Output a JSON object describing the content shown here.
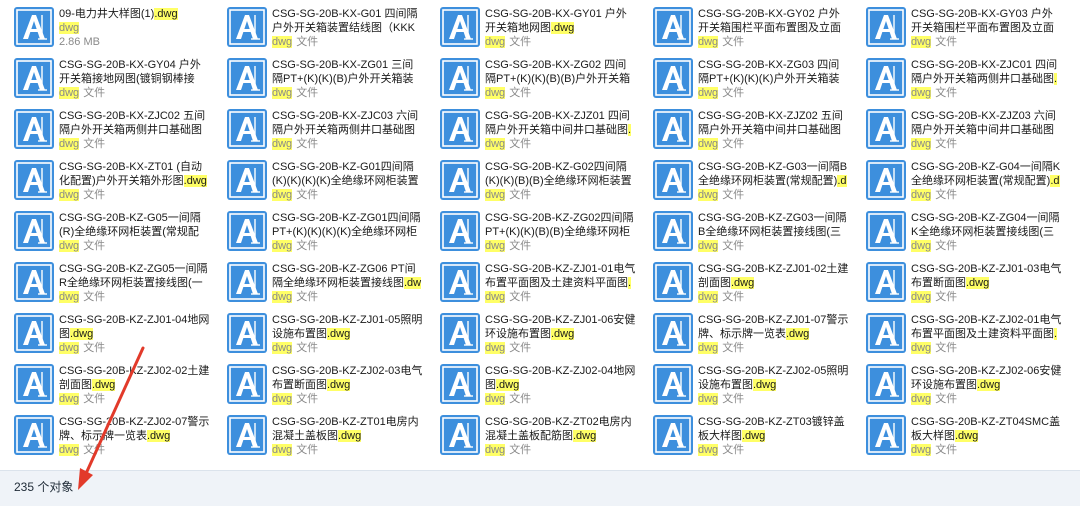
{
  "colors": {
    "icon_bg": "#3d8fdd",
    "icon_frame": "#ffffff",
    "highlight": "#ffff66",
    "arrow": "#e23a2a",
    "statusbar": "#eff3f8"
  },
  "file_icon": "autocad-dwg-icon",
  "items": [
    {
      "name_prefix": "09-电力井大样图(1)",
      "ext": ".dwg",
      "type_ext": "dwg",
      "type_suffix": "",
      "size": "2.86 MB"
    },
    {
      "name_prefix": "CSG-SG-20B-KX-G01 四间隔户外开关箱装置结线图（KKKK)(常规配置)",
      "ext": "",
      "type_ext": "dwg",
      "type_suffix": "文件",
      "size": ""
    },
    {
      "name_prefix": "CSG-SG-20B-KX-GY01 户外开关箱地网图",
      "ext": ".dwg",
      "type_ext": "dwg",
      "type_suffix": "文件",
      "size": ""
    },
    {
      "name_prefix": "CSG-SG-20B-KX-GY02 户外开关箱围栏平面布置图及立面图（两间隔）",
      "ext": "",
      "type_ext": "dwg",
      "type_suffix": "文件",
      "size": ""
    },
    {
      "name_prefix": "CSG-SG-20B-KX-GY03 户外开关箱围栏平面布置图及立面图（中间隔）",
      "ext": "",
      "type_ext": "dwg",
      "type_suffix": "文件",
      "size": ""
    },
    {
      "name_prefix": "CSG-SG-20B-KX-GY04 户外开关箱接地网图(镀铜钢棒接地)",
      "ext": ".dwg",
      "type_ext": "dwg",
      "type_suffix": "文件",
      "size": ""
    },
    {
      "name_prefix": "CSG-SG-20B-KX-ZG01 三间隔PT+(K)(K)(B)户外开关箱装置结线图",
      "ext": "",
      "type_ext": "dwg",
      "type_suffix": "文件",
      "size": ""
    },
    {
      "name_prefix": "CSG-SG-20B-KX-ZG02 四间隔PT+(K)(K)(B)(B)户外开关箱装置结线图",
      "ext": "",
      "type_ext": "dwg",
      "type_suffix": "文件",
      "size": ""
    },
    {
      "name_prefix": "CSG-SG-20B-KX-ZG03 四间隔PT+(K)(K)(K)户外开关箱装置结线图",
      "ext": "",
      "type_ext": "dwg",
      "type_suffix": "文件",
      "size": ""
    },
    {
      "name_prefix": "CSG-SG-20B-KX-ZJC01 四间隔户外开关箱两侧井口基础图",
      "ext": ".dwg",
      "type_ext": "dwg",
      "type_suffix": "文件",
      "size": ""
    },
    {
      "name_prefix": "CSG-SG-20B-KX-ZJC02 五间隔户外开关箱两侧井口基础图(自动化配置)",
      "ext": "",
      "type_ext": "dwg",
      "type_suffix": "文件",
      "size": ""
    },
    {
      "name_prefix": "CSG-SG-20B-KX-ZJC03 六间隔户外开关箱两侧井口基础图(自动化配置)",
      "ext": "",
      "type_ext": "dwg",
      "type_suffix": "文件",
      "size": ""
    },
    {
      "name_prefix": "CSG-SG-20B-KX-ZJZ01 四间隔户外开关箱中间井口基础图",
      "ext": ".dwg",
      "type_ext": "dwg",
      "type_suffix": "文件",
      "size": ""
    },
    {
      "name_prefix": "CSG-SG-20B-KX-ZJZ02 五间隔户外开关箱中间井口基础图(自动化配置)",
      "ext": "",
      "type_ext": "dwg",
      "type_suffix": "文件",
      "size": ""
    },
    {
      "name_prefix": "CSG-SG-20B-KX-ZJZ03 六间隔户外开关箱中间井口基础图(自动化配置)",
      "ext": "",
      "type_ext": "dwg",
      "type_suffix": "文件",
      "size": ""
    },
    {
      "name_prefix": "CSG-SG-20B-KX-ZT01 (自动化配置)户外开关箱外形图",
      "ext": ".dwg",
      "type_ext": "dwg",
      "type_suffix": "文件",
      "size": ""
    },
    {
      "name_prefix": "CSG-SG-20B-KZ-G01四间隔(K)(K)(K)(K)全绝缘环网柜装置(常规配置)",
      "ext": "",
      "type_ext": "dwg",
      "type_suffix": "文件",
      "size": ""
    },
    {
      "name_prefix": "CSG-SG-20B-KZ-G02四间隔(K)(K)(B)(B)全绝缘环网柜装置(常规配置)",
      "ext": "",
      "type_ext": "dwg",
      "type_suffix": "文件",
      "size": ""
    },
    {
      "name_prefix": "CSG-SG-20B-KZ-G03一间隔B全绝缘环网柜装置(常规配置)",
      "ext": ".dwg",
      "type_ext": "dwg",
      "type_suffix": "文件",
      "size": ""
    },
    {
      "name_prefix": "CSG-SG-20B-KZ-G04一间隔K全绝缘环网柜装置(常规配置)",
      "ext": ".dwg",
      "type_ext": "dwg",
      "type_suffix": "文件",
      "size": ""
    },
    {
      "name_prefix": "CSG-SG-20B-KZ-G05一间隔(R)全绝缘环网柜装置(常规配置)",
      "ext": ".dwg",
      "type_ext": "dwg",
      "type_suffix": "文件",
      "size": ""
    },
    {
      "name_prefix": "CSG-SG-20B-KZ-ZG01四间隔PT+(K)(K)(K)(K)全绝缘环网柜装置接线图",
      "ext": "",
      "type_ext": "dwg",
      "type_suffix": "文件",
      "size": ""
    },
    {
      "name_prefix": "CSG-SG-20B-KZ-ZG02四间隔PT+(K)(K)(B)(B)全绝缘环网柜装置接线图",
      "ext": "",
      "type_ext": "dwg",
      "type_suffix": "文件",
      "size": ""
    },
    {
      "name_prefix": "CSG-SG-20B-KZ-ZG03一间隔B全绝缘环网柜装置接线图(三遥配置)",
      "ext": ".dwg",
      "type_ext": "dwg",
      "type_suffix": "文件",
      "size": ""
    },
    {
      "name_prefix": "CSG-SG-20B-KZ-ZG04一间隔K全绝缘环网柜装置接线图(三遥配置)",
      "ext": ".dwg",
      "type_ext": "dwg",
      "type_suffix": "文件",
      "size": ""
    },
    {
      "name_prefix": "CSG-SG-20B-KZ-ZG05一间隔R全绝缘环网柜装置接线图(一遥配置)",
      "ext": ".dwg",
      "type_ext": "dwg",
      "type_suffix": "文件",
      "size": ""
    },
    {
      "name_prefix": "CSG-SG-20B-KZ-ZG06 PT间隔全绝缘环网柜装置接线图",
      "ext": ".dwg",
      "type_ext": "dwg",
      "type_suffix": "文件",
      "size": ""
    },
    {
      "name_prefix": "CSG-SG-20B-KZ-ZJ01-01电气布置平面图及土建资料平面图",
      "ext": ".dwg",
      "type_ext": "dwg",
      "type_suffix": "文件",
      "size": ""
    },
    {
      "name_prefix": "CSG-SG-20B-KZ-ZJ01-02土建剖面图",
      "ext": ".dwg",
      "type_ext": "dwg",
      "type_suffix": "文件",
      "size": ""
    },
    {
      "name_prefix": "CSG-SG-20B-KZ-ZJ01-03电气布置断面图",
      "ext": ".dwg",
      "type_ext": "dwg",
      "type_suffix": "文件",
      "size": ""
    },
    {
      "name_prefix": "CSG-SG-20B-KZ-ZJ01-04地网图",
      "ext": ".dwg",
      "type_ext": "dwg",
      "type_suffix": "文件",
      "size": ""
    },
    {
      "name_prefix": "CSG-SG-20B-KZ-ZJ01-05照明设施布置图",
      "ext": ".dwg",
      "type_ext": "dwg",
      "type_suffix": "文件",
      "size": ""
    },
    {
      "name_prefix": "CSG-SG-20B-KZ-ZJ01-06安健环设施布置图",
      "ext": ".dwg",
      "type_ext": "dwg",
      "type_suffix": "文件",
      "size": ""
    },
    {
      "name_prefix": "CSG-SG-20B-KZ-ZJ01-07警示牌、标示牌一览表",
      "ext": ".dwg",
      "type_ext": "dwg",
      "type_suffix": "文件",
      "size": ""
    },
    {
      "name_prefix": "CSG-SG-20B-KZ-ZJ02-01电气布置平面图及土建资料平面图",
      "ext": ".dwg",
      "type_ext": "dwg",
      "type_suffix": "文件",
      "size": ""
    },
    {
      "name_prefix": "CSG-SG-20B-KZ-ZJ02-02土建剖面图",
      "ext": ".dwg",
      "type_ext": "dwg",
      "type_suffix": "文件",
      "size": ""
    },
    {
      "name_prefix": "CSG-SG-20B-KZ-ZJ02-03电气布置断面图",
      "ext": ".dwg",
      "type_ext": "dwg",
      "type_suffix": "文件",
      "size": ""
    },
    {
      "name_prefix": "CSG-SG-20B-KZ-ZJ02-04地网图",
      "ext": ".dwg",
      "type_ext": "dwg",
      "type_suffix": "文件",
      "size": ""
    },
    {
      "name_prefix": "CSG-SG-20B-KZ-ZJ02-05照明设施布置图",
      "ext": ".dwg",
      "type_ext": "dwg",
      "type_suffix": "文件",
      "size": ""
    },
    {
      "name_prefix": "CSG-SG-20B-KZ-ZJ02-06安健环设施布置图",
      "ext": ".dwg",
      "type_ext": "dwg",
      "type_suffix": "文件",
      "size": ""
    },
    {
      "name_prefix": "CSG-SG-20B-KZ-ZJ02-07警示牌、标示牌一览表",
      "ext": ".dwg",
      "type_ext": "dwg",
      "type_suffix": "文件",
      "size": ""
    },
    {
      "name_prefix": "CSG-SG-20B-KZ-ZT01电房内混凝土盖板图",
      "ext": ".dwg",
      "type_ext": "dwg",
      "type_suffix": "文件",
      "size": ""
    },
    {
      "name_prefix": "CSG-SG-20B-KZ-ZT02电房内混凝土盖板配筋图",
      "ext": ".dwg",
      "type_ext": "dwg",
      "type_suffix": "文件",
      "size": ""
    },
    {
      "name_prefix": "CSG-SG-20B-KZ-ZT03镀锌盖板大样图",
      "ext": ".dwg",
      "type_ext": "dwg",
      "type_suffix": "文件",
      "size": ""
    },
    {
      "name_prefix": "CSG-SG-20B-KZ-ZT04SMC盖板大样图",
      "ext": ".dwg",
      "type_ext": "dwg",
      "type_suffix": "文件",
      "size": ""
    }
  ],
  "status": {
    "count_text": "235 个对象"
  }
}
